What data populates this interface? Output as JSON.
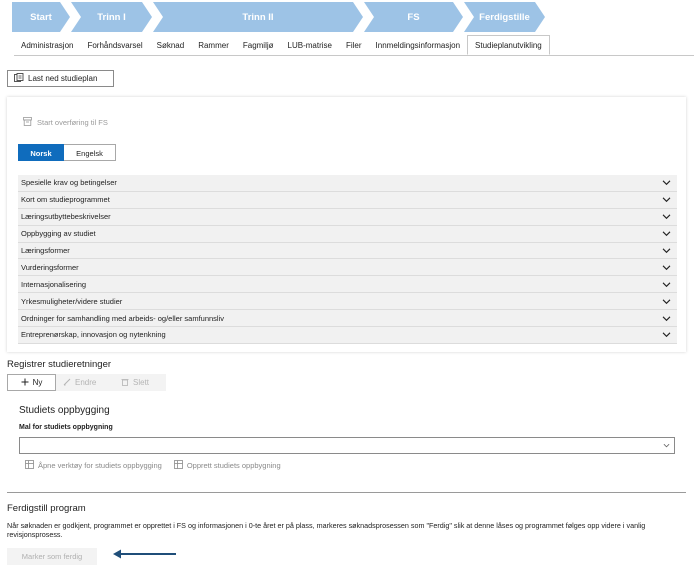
{
  "stepper": {
    "steps": [
      "Start",
      "Trinn I",
      "Trinn II",
      "FS",
      "Ferdigstille"
    ],
    "color": "#9dc3e6",
    "active_color": "#8fb9e2"
  },
  "tabs": [
    "Administrasjon",
    "Forhåndsvarsel",
    "Søknad",
    "Rammer",
    "Fagmiljø",
    "LUB-matrise",
    "Filer",
    "Innmeldingsinformasjon",
    "Studieplanutvikling"
  ],
  "active_tab": "Studieplanutvikling",
  "download_button": {
    "label": "Last ned studieplan",
    "icon": "document-download-icon"
  },
  "transfer": {
    "label": "Start overføring til FS",
    "icon": "archive-icon"
  },
  "language": {
    "options": [
      "Norsk",
      "Engelsk"
    ],
    "selected": "Norsk",
    "accent": "#0f6cbd"
  },
  "accordion": [
    "Spesielle krav og betingelser",
    "Kort om studieprogrammet",
    "Læringsutbyttebeskrivelser",
    "Oppbygging av studiet",
    "Læringsformer",
    "Vurderingsformer",
    "Internasjonalisering",
    "Yrkesmuligheter/videre studier",
    "Ordninger for samhandling med arbeids- og/eller samfunnsliv",
    "Entreprenørskap, innovasjon og nytenkning"
  ],
  "studieretninger": {
    "title": "Registrer studieretninger",
    "new_label": "Ny",
    "edit_label": "Endre",
    "delete_label": "Slett"
  },
  "oppbygging": {
    "title": "Studiets oppbygging",
    "field_label": "Mal for studiets oppbygning",
    "value": "",
    "open_tool_label": "Åpne verktøy for studiets oppbygging",
    "create_label": "Opprett studiets oppbygning"
  },
  "finish": {
    "title": "Ferdigstill program",
    "description": "Når søknaden er godkjent, programmet er opprettet i FS og informasjonen i 0-te året er på plass, markeres søknadsprosessen som \"Ferdig\" slik at denne låses og programmet følges opp videre i vanlig revisjonsprosess.",
    "button_label": "Marker som ferdig",
    "arrow_color": "#1f4e79"
  }
}
